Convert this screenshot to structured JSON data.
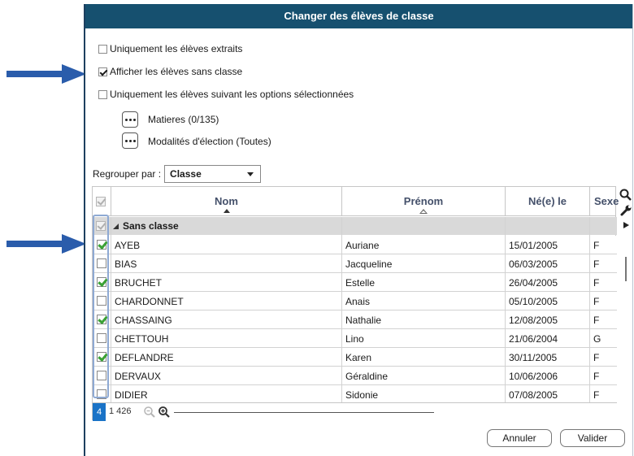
{
  "dialog": {
    "title": "Changer des élèves de classe"
  },
  "options": {
    "extracted_only": {
      "label": "Uniquement les élèves extraits",
      "checked": false
    },
    "show_unassigned": {
      "label": "Afficher les élèves sans classe",
      "checked": true
    },
    "selected_options_only": {
      "label": "Uniquement les élèves suivant les options sélectionnées",
      "checked": false
    },
    "subjects": "Matieres (0/135)",
    "election_modes": "Modalités d'élection (Toutes)"
  },
  "group_by": {
    "label": "Regrouper par :",
    "value": "Classe"
  },
  "table": {
    "columns": {
      "nom": "Nom",
      "prenom": "Prénom",
      "birth": "Né(e) le",
      "sexe": "Sexe"
    },
    "group_label": "Sans classe",
    "rows": [
      {
        "nom": "AYEB",
        "prenom": "Auriane",
        "birth": "15/01/2005",
        "sexe": "F",
        "checked": true
      },
      {
        "nom": "BIAS",
        "prenom": "Jacqueline",
        "birth": "06/03/2005",
        "sexe": "F",
        "checked": false
      },
      {
        "nom": "BRUCHET",
        "prenom": "Estelle",
        "birth": "26/04/2005",
        "sexe": "F",
        "checked": true
      },
      {
        "nom": "CHARDONNET",
        "prenom": "Anais",
        "birth": "05/10/2005",
        "sexe": "F",
        "checked": false
      },
      {
        "nom": "CHASSAING",
        "prenom": "Nathalie",
        "birth": "12/08/2005",
        "sexe": "F",
        "checked": true
      },
      {
        "nom": "CHETTOUH",
        "prenom": "Lino",
        "birth": "21/06/2004",
        "sexe": "G",
        "checked": false
      },
      {
        "nom": "DEFLANDRE",
        "prenom": "Karen",
        "birth": "30/11/2005",
        "sexe": "F",
        "checked": true
      },
      {
        "nom": "DERVAUX",
        "prenom": "Géraldine",
        "birth": "10/06/2006",
        "sexe": "F",
        "checked": false
      },
      {
        "nom": "DIDIER",
        "prenom": "Sidonie",
        "birth": "07/08/2005",
        "sexe": "F",
        "checked": false
      }
    ],
    "selected_count": "4",
    "total_count": "1 426"
  },
  "buttons": {
    "cancel": "Annuler",
    "validate": "Valider"
  },
  "colors": {
    "titlebar": "#16506f",
    "arrow": "#2a5cab",
    "check_green": "#3aa135",
    "count_badge": "#1a73c7"
  }
}
